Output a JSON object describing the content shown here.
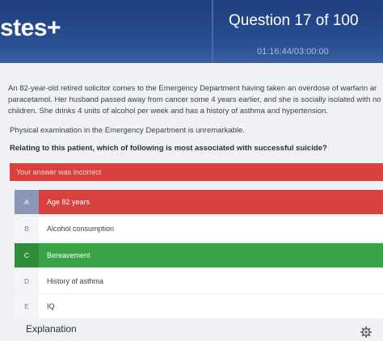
{
  "header": {
    "logo": "stes+",
    "question_counter": "Question 17 of 100",
    "timer": "01:16:44/03:00:00"
  },
  "question": {
    "stem_lines": [
      "An 82-year-old retired solicitor comes to the Emergency Department having taken an overdose of warfarin ar",
      "paracetamol. Her husband passed away from cancer some 4 years earlier, and she is socially isolated with no",
      "children. She drinks 4 units of alcohol per week and has a history of asthma and hypertension."
    ],
    "exam": "Physical examination in the Emergency Department is unremarkable.",
    "prompt": "Relating to this patient, which of following is most associated with successful suicide?"
  },
  "result": "Your answer was incorrect",
  "options": [
    {
      "letter": "A",
      "text": "Age 82 years",
      "state": "incorrect"
    },
    {
      "letter": "B",
      "text": "Alcohol consumption",
      "state": "neutral"
    },
    {
      "letter": "C",
      "text": "Bereavement",
      "state": "correct"
    },
    {
      "letter": "D",
      "text": "History of asthma",
      "state": "neutral"
    },
    {
      "letter": "E",
      "text": "IQ",
      "state": "neutral"
    }
  ],
  "explanation_label": "Explanation",
  "icons": {
    "settings": "gear-icon"
  },
  "colors": {
    "incorrect": "#d9413e",
    "correct": "#3aa546",
    "header": "#2a4f94"
  }
}
